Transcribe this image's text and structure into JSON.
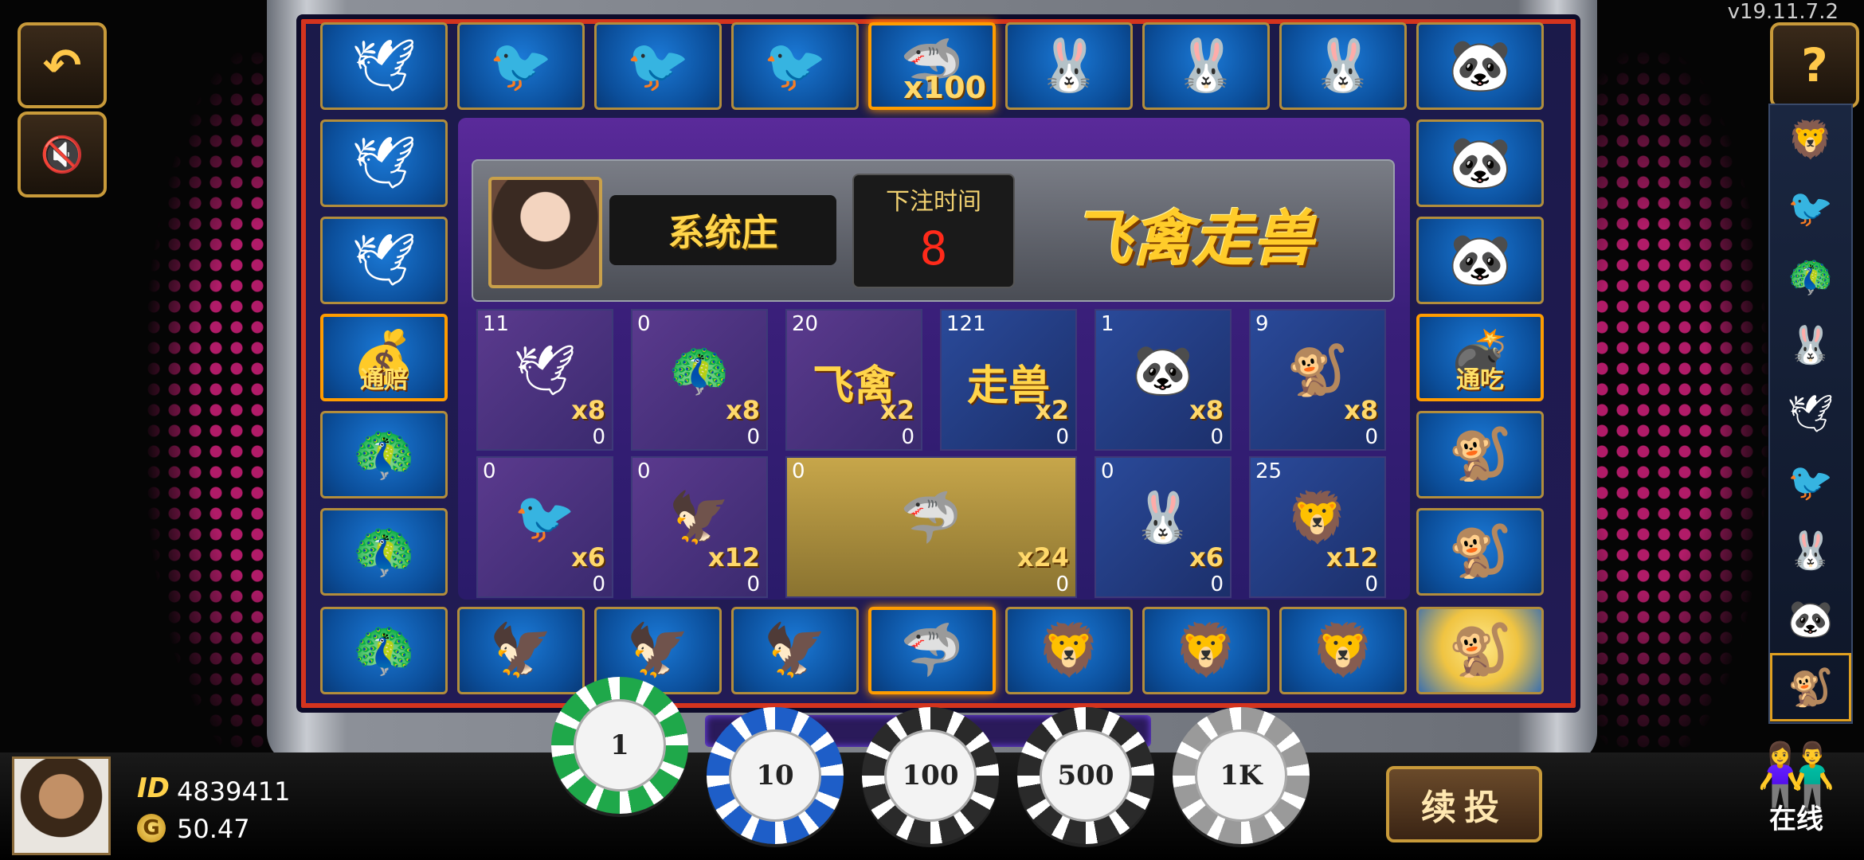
{
  "version": "v19.11.7.2",
  "buttons": {
    "back_icon": "↶",
    "mute_icon": "🔇",
    "help_label": "?",
    "repeat_label": "续投"
  },
  "banker": {
    "label": "系统庄"
  },
  "timer": {
    "label": "下注时间",
    "value": "8"
  },
  "game_title": "飞禽走兽",
  "ring": {
    "top": [
      {
        "animal": "dove",
        "icon": "🕊"
      },
      {
        "animal": "swallow",
        "icon": "🐦"
      },
      {
        "animal": "swallow",
        "icon": "🐦"
      },
      {
        "animal": "swallow",
        "icon": "🐦"
      },
      {
        "animal": "gold-shark",
        "icon": "🦈",
        "label": "x100"
      },
      {
        "animal": "rabbit",
        "icon": "🐰"
      },
      {
        "animal": "rabbit",
        "icon": "🐰"
      },
      {
        "animal": "rabbit",
        "icon": "🐰"
      },
      {
        "animal": "panda",
        "icon": "🐼"
      }
    ],
    "left": [
      {
        "animal": "dove",
        "icon": "🕊"
      },
      {
        "animal": "dove",
        "icon": "🕊"
      },
      {
        "animal": "treasure",
        "icon": "💰",
        "label": "通赔"
      },
      {
        "animal": "peacock",
        "icon": "🦚"
      },
      {
        "animal": "peacock",
        "icon": "🦚"
      }
    ],
    "right": [
      {
        "animal": "panda",
        "icon": "🐼"
      },
      {
        "animal": "panda",
        "icon": "🐼"
      },
      {
        "animal": "bomb",
        "icon": "💣",
        "label": "通吃"
      },
      {
        "animal": "monkey",
        "icon": "🐒"
      },
      {
        "animal": "monkey",
        "icon": "🐒"
      }
    ],
    "bottom": [
      {
        "animal": "peacock",
        "icon": "🦚"
      },
      {
        "animal": "eagle",
        "icon": "🦅"
      },
      {
        "animal": "eagle",
        "icon": "🦅"
      },
      {
        "animal": "eagle",
        "icon": "🦅"
      },
      {
        "animal": "shark",
        "icon": "🦈"
      },
      {
        "animal": "lion",
        "icon": "🦁"
      },
      {
        "animal": "lion",
        "icon": "🦁"
      },
      {
        "animal": "lion",
        "icon": "🦁"
      },
      {
        "animal": "monkey",
        "icon": "🐒"
      }
    ]
  },
  "bets": [
    {
      "name": "dove",
      "count": "11",
      "icon": "🕊",
      "mult": "x8",
      "stake": "0",
      "tone": "purple"
    },
    {
      "name": "peacock",
      "count": "0",
      "icon": "🦚",
      "mult": "x8",
      "stake": "0",
      "tone": "purple"
    },
    {
      "name": "birds",
      "count": "20",
      "word": "飞禽",
      "mult": "x2",
      "stake": "0",
      "tone": "purple"
    },
    {
      "name": "beasts",
      "count": "121",
      "word": "走兽",
      "mult": "x2",
      "stake": "0",
      "tone": "blue"
    },
    {
      "name": "panda",
      "count": "1",
      "icon": "🐼",
      "mult": "x8",
      "stake": "0",
      "tone": "blue"
    },
    {
      "name": "monkey",
      "count": "9",
      "icon": "🐒",
      "mult": "x8",
      "stake": "0",
      "tone": "blue"
    },
    {
      "name": "swallow",
      "count": "0",
      "icon": "🐦",
      "mult": "x6",
      "stake": "0",
      "tone": "purple"
    },
    {
      "name": "eagle",
      "count": "0",
      "icon": "🦅",
      "mult": "x12",
      "stake": "0",
      "tone": "purple"
    },
    {
      "name": "shark",
      "count": "0",
      "icon": "🦈",
      "mult": "x24",
      "stake": "0",
      "tone": "gold"
    },
    {
      "name": "rabbit",
      "count": "0",
      "icon": "🐰",
      "mult": "x6",
      "stake": "0",
      "tone": "blue"
    },
    {
      "name": "lion",
      "count": "25",
      "icon": "🦁",
      "mult": "x12",
      "stake": "0",
      "tone": "blue"
    }
  ],
  "history": [
    "🦁",
    "🐦",
    "🦚",
    "🐰",
    "🕊",
    "🐦",
    "🐰",
    "🐼",
    "🐒"
  ],
  "player": {
    "id_label": "ID",
    "id": "4839411",
    "coin_icon": "G",
    "balance": "50.47"
  },
  "chips": [
    {
      "label": "1",
      "color": "#1fa84a"
    },
    {
      "label": "10",
      "color": "#1e5ec8"
    },
    {
      "label": "100",
      "color": "#2a2a2a"
    },
    {
      "label": "500",
      "color": "#2a2a2a"
    },
    {
      "label": "1K",
      "color": "#9a9a9a"
    }
  ],
  "online": {
    "icon": "👫",
    "label": "在线"
  }
}
